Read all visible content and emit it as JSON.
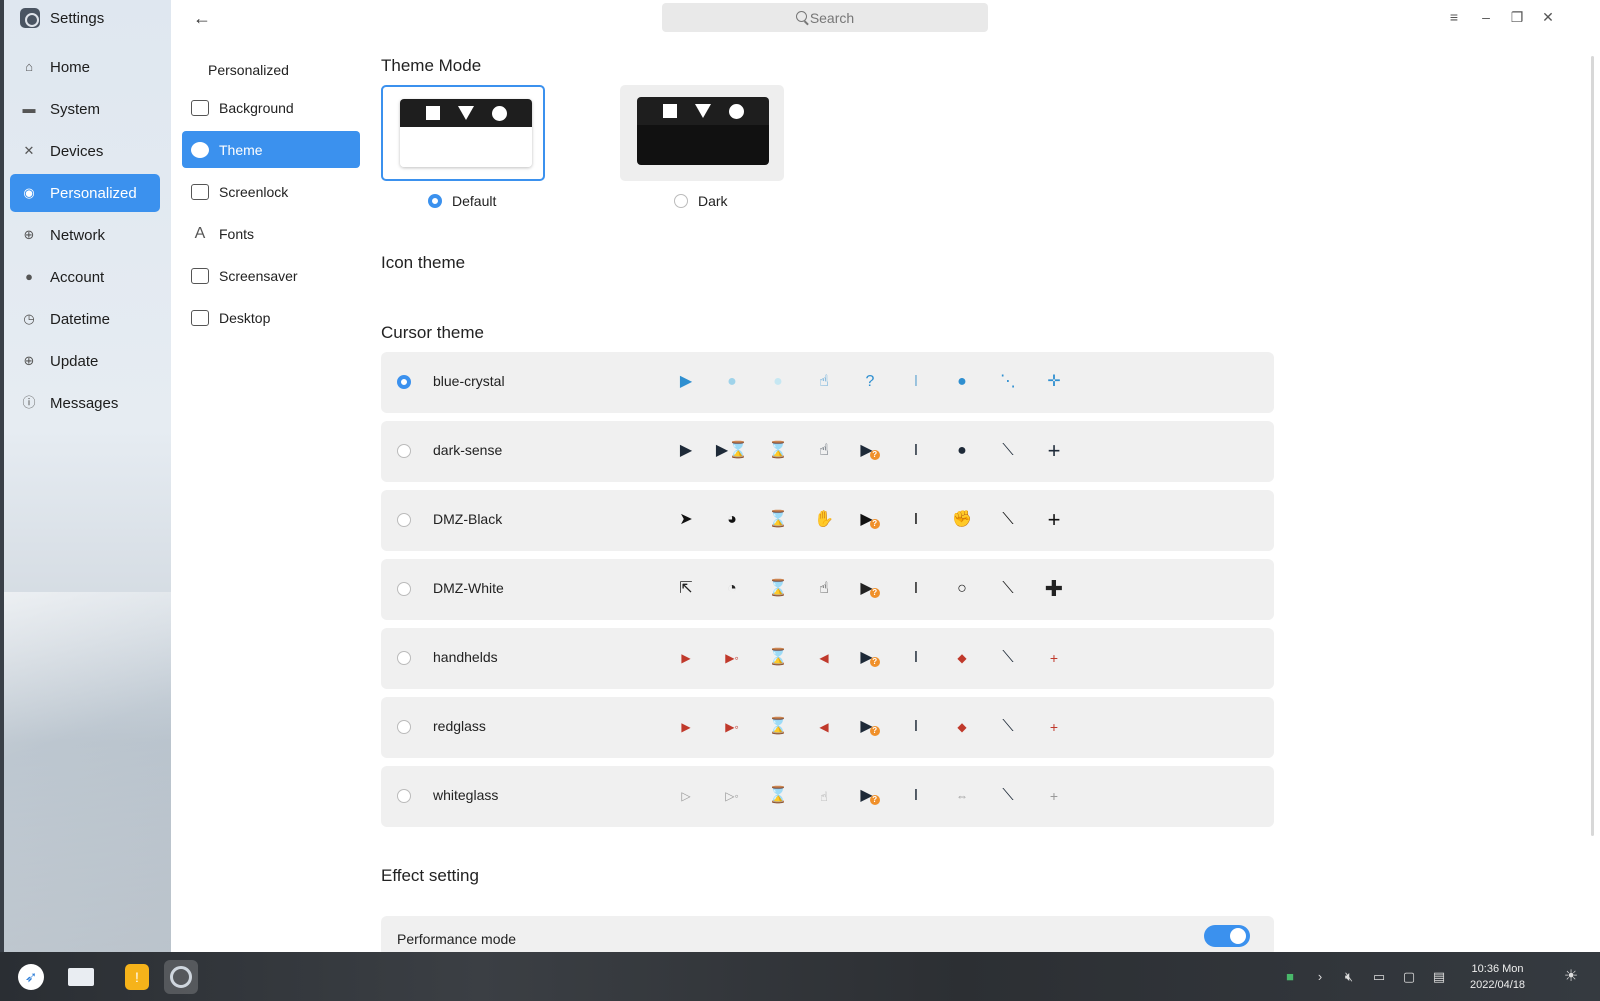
{
  "app": {
    "title": "Settings"
  },
  "sidebar": {
    "items": [
      {
        "label": "Home",
        "icon": "home-icon"
      },
      {
        "label": "System",
        "icon": "monitor-icon"
      },
      {
        "label": "Devices",
        "icon": "devices-icon"
      },
      {
        "label": "Personalized",
        "icon": "palette-icon",
        "active": true
      },
      {
        "label": "Network",
        "icon": "globe-icon"
      },
      {
        "label": "Account",
        "icon": "user-icon"
      },
      {
        "label": "Datetime",
        "icon": "clock-icon"
      },
      {
        "label": "Update",
        "icon": "update-icon"
      },
      {
        "label": "Messages",
        "icon": "info-icon"
      }
    ]
  },
  "subnav": {
    "header": "Personalized",
    "items": [
      {
        "label": "Background",
        "icon": "image-icon"
      },
      {
        "label": "Theme",
        "icon": "palette-icon",
        "active": true
      },
      {
        "label": "Screenlock",
        "icon": "screenlock-icon"
      },
      {
        "label": "Fonts",
        "icon": "font-icon"
      },
      {
        "label": "Screensaver",
        "icon": "screensaver-icon"
      },
      {
        "label": "Desktop",
        "icon": "desktop-icon"
      }
    ]
  },
  "search": {
    "placeholder": "Search"
  },
  "theme_mode": {
    "title": "Theme Mode",
    "options": [
      {
        "label": "Default",
        "selected": true
      },
      {
        "label": "Dark",
        "selected": false
      }
    ]
  },
  "icon_theme": {
    "title": "Icon theme"
  },
  "cursor_theme": {
    "title": "Cursor theme",
    "themes": [
      {
        "name": "blue-crystal",
        "selected": true
      },
      {
        "name": "dark-sense",
        "selected": false
      },
      {
        "name": "DMZ-Black",
        "selected": false
      },
      {
        "name": "DMZ-White",
        "selected": false
      },
      {
        "name": "handhelds",
        "selected": false
      },
      {
        "name": "redglass",
        "selected": false
      },
      {
        "name": "whiteglass",
        "selected": false
      }
    ]
  },
  "effect": {
    "title": "Effect setting",
    "performance_mode": {
      "label": "Performance mode",
      "enabled": true
    }
  },
  "taskbar": {
    "clock_time": "10:36 Mon",
    "clock_date": "2022/04/18"
  },
  "colors": {
    "accent": "#3b91ee",
    "badge": "#f0902a"
  }
}
